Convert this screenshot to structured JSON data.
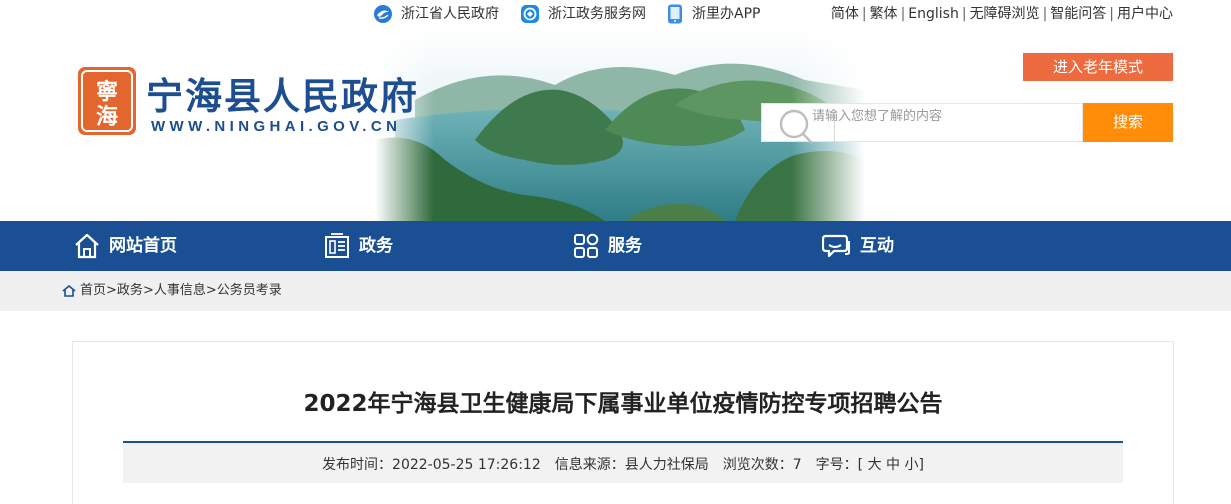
{
  "topbar": {
    "links": [
      {
        "label": "浙江省人民政府",
        "icon": "zhejiang-gov-icon"
      },
      {
        "label": "浙江政务服务网",
        "icon": "zj-service-icon"
      },
      {
        "label": "浙里办APP",
        "icon": "mobile-app-icon"
      }
    ],
    "utils": [
      "简体",
      "繁体",
      "English",
      "无障碍浏览",
      "智能问答",
      "用户中心"
    ]
  },
  "header": {
    "logo_seal_text": "宁海",
    "site_name": "宁海县人民政府",
    "site_domain": "WWW.NINGHAI.GOV.CN",
    "elder_mode_label": "进入老年模式",
    "search_placeholder": "请输入您想了解的内容",
    "search_button": "搜索"
  },
  "nav": {
    "items": [
      {
        "label": "网站首页",
        "icon": "home-icon"
      },
      {
        "label": "政务",
        "icon": "document-icon"
      },
      {
        "label": "服务",
        "icon": "grid-icon"
      },
      {
        "label": "互动",
        "icon": "chat-icon"
      }
    ]
  },
  "breadcrumb": {
    "items": [
      "首页",
      "政务",
      "人事信息",
      "公务员考录"
    ],
    "separator": ">"
  },
  "article": {
    "title": "2022年宁海县卫生健康局下属事业单位疫情防控专项招聘公告",
    "publish_label": "发布时间：",
    "publish_time": "2022-05-25 17:26:12",
    "source_label": "信息来源：",
    "source": "县人力社保局",
    "views_label": "浏览次数：",
    "views": "7",
    "fontsize_label": "字号：",
    "fontsize_open": "[",
    "fontsize_large": "大",
    "fontsize_medium": "中",
    "fontsize_small": "小",
    "fontsize_close": "]"
  },
  "colors": {
    "brand_blue": "#1a4f94",
    "accent_orange": "#ed6b3e",
    "search_orange": "#ff8d0a"
  }
}
